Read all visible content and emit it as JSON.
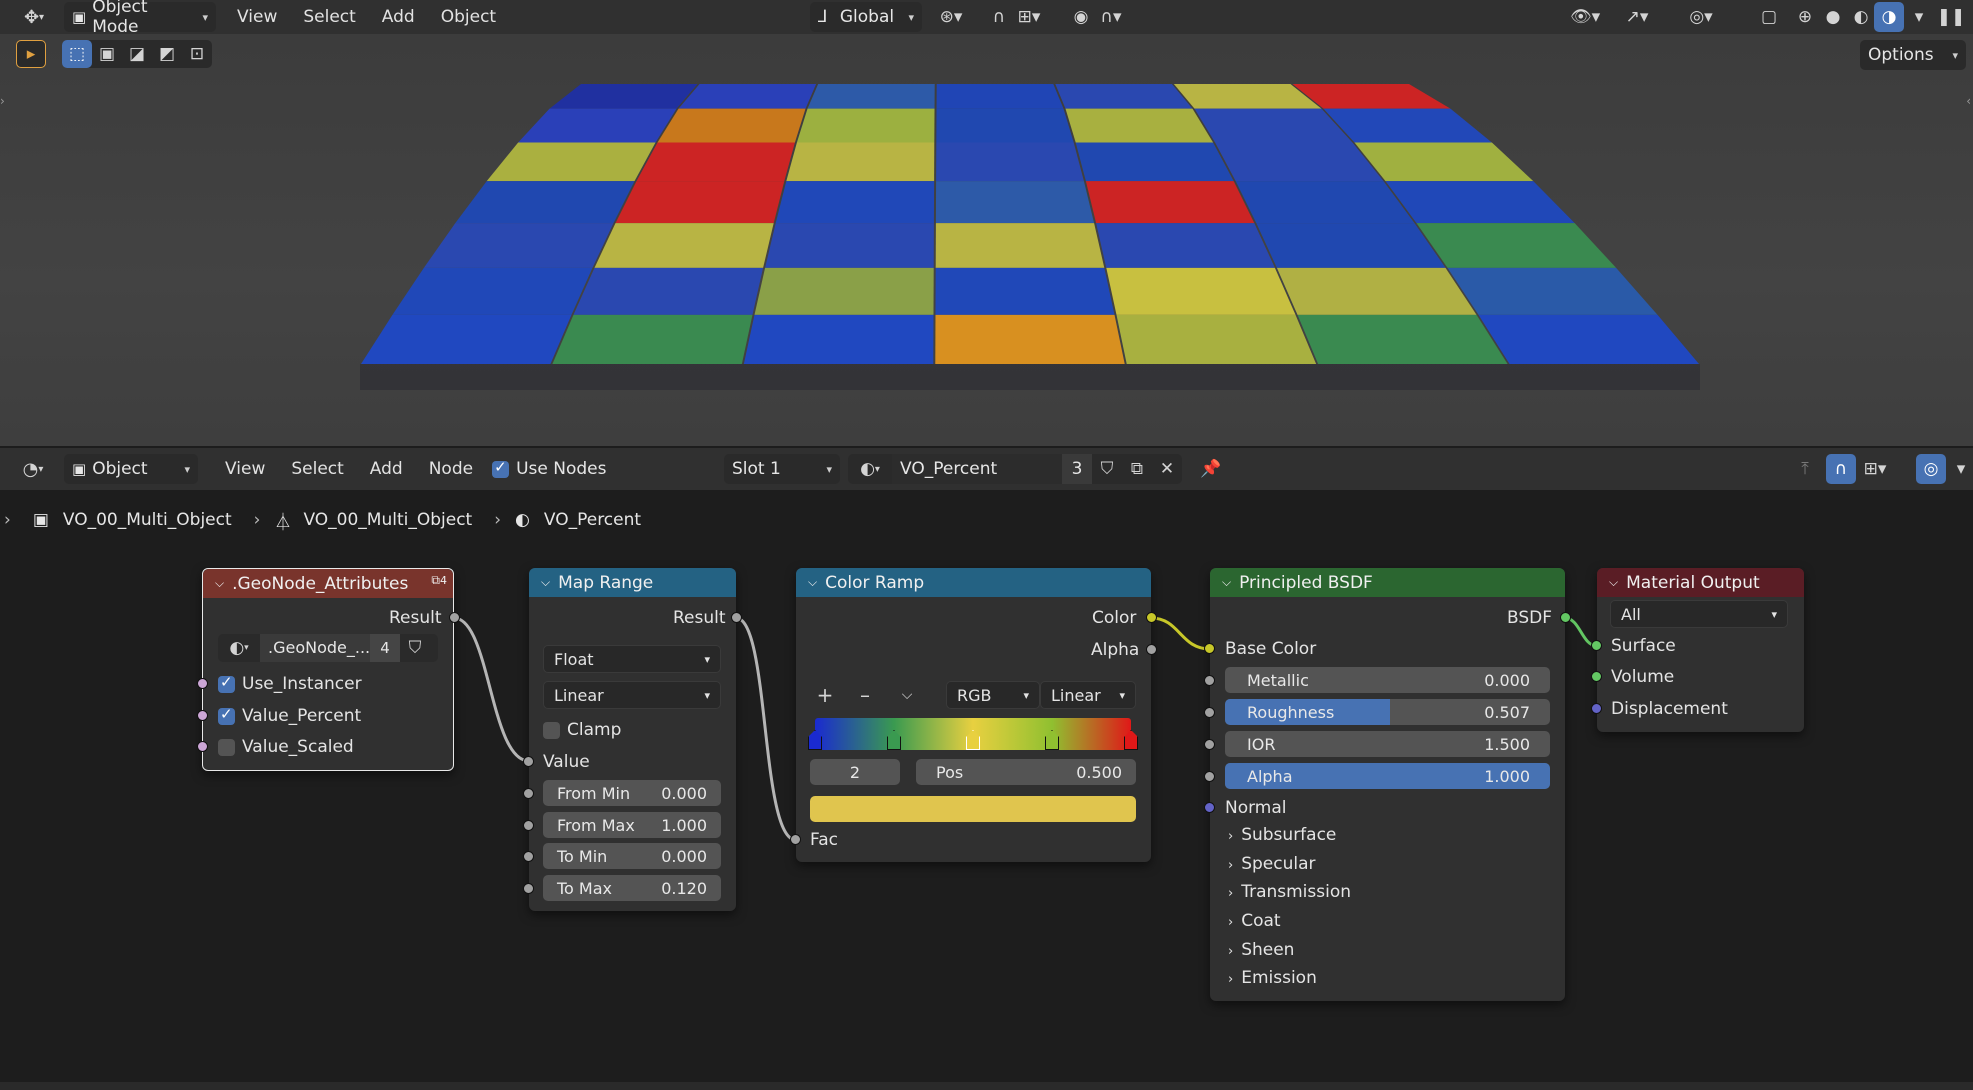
{
  "top_header": {
    "mode_label": "Object Mode",
    "menus": [
      "View",
      "Select",
      "Add",
      "Object"
    ],
    "orientation": "Global",
    "options_label": "Options"
  },
  "viewport": {
    "tile_colors": [
      [
        "#2030a0",
        "#2a40b8",
        "#2d5aa8",
        "#2045b5",
        "#2a48b0",
        "#b8b444",
        "#cc2424"
      ],
      [
        "#2a40b8",
        "#c8781c",
        "#9cb040",
        "#2048b0",
        "#a8b040",
        "#2a48b0",
        "#2248b8"
      ],
      [
        "#aab040",
        "#cc2424",
        "#b8b444",
        "#2a48b0",
        "#2048b0",
        "#2a48b0",
        "#a0b040"
      ],
      [
        "#2048b0",
        "#cc2424",
        "#2048b8",
        "#2d5aa8",
        "#cc2424",
        "#2048b0",
        "#2048b8"
      ],
      [
        "#2a48b0",
        "#b8b444",
        "#2a48b0",
        "#b8b444",
        "#2a48b0",
        "#2048b0",
        "#3a8a50"
      ],
      [
        "#2048b8",
        "#2a48b0",
        "#8aa048",
        "#2048b8",
        "#c8c040",
        "#b0b044",
        "#2a5aa8"
      ],
      [
        "#2048c0",
        "#3a8a50",
        "#2048c0",
        "#d89020",
        "#a8b040",
        "#3a8a50",
        "#2048c0"
      ]
    ]
  },
  "node_header": {
    "editor_type": "Object",
    "menus": [
      "View",
      "Select",
      "Add",
      "Node"
    ],
    "use_nodes_label": "Use Nodes",
    "slot": "Slot 1",
    "material_name": "VO_Percent",
    "user_count": "3"
  },
  "breadcrumb": {
    "object": "VO_00_Multi_Object",
    "mesh": "VO_00_Multi_Object",
    "material": "VO_Percent"
  },
  "nodes": {
    "geonode": {
      "title": ".GeoNode_Attributes",
      "badge": "4",
      "output": "Result",
      "datablock": ".GeoNode_...",
      "datablock_count": "4",
      "inputs": [
        {
          "label": "Use_Instancer",
          "checked": true
        },
        {
          "label": "Value_Percent",
          "checked": true
        },
        {
          "label": "Value_Scaled",
          "checked": false
        }
      ]
    },
    "map_range": {
      "title": "Map Range",
      "output": "Result",
      "data_type": "Float",
      "interpolation": "Linear",
      "clamp_label": "Clamp",
      "value_label": "Value",
      "fields": [
        {
          "label": "From Min",
          "value": "0.000"
        },
        {
          "label": "From Max",
          "value": "1.000"
        },
        {
          "label": "To Min",
          "value": "0.000"
        },
        {
          "label": "To Max",
          "value": "0.120"
        }
      ]
    },
    "color_ramp": {
      "title": "Color Ramp",
      "outputs": [
        "Color",
        "Alpha"
      ],
      "color_mode": "RGB",
      "interpolation": "Linear",
      "active_index": "2",
      "pos_label": "Pos",
      "pos_value": "0.500",
      "active_color": "#e0c54e",
      "input": "Fac",
      "stops": [
        {
          "pos": 0.0,
          "color": "#1a2ad0"
        },
        {
          "pos": 0.25,
          "color": "#3a9a50"
        },
        {
          "pos": 0.5,
          "color": "#e8d040"
        },
        {
          "pos": 0.75,
          "color": "#90c030"
        },
        {
          "pos": 1.0,
          "color": "#e01818"
        }
      ]
    },
    "bsdf": {
      "title": "Principled BSDF",
      "output": "BSDF",
      "base_color_label": "Base Color",
      "fields": [
        {
          "label": "Metallic",
          "value": "0.000",
          "fill": 0.0
        },
        {
          "label": "Roughness",
          "value": "0.507",
          "fill": 0.507
        },
        {
          "label": "IOR",
          "value": "1.500",
          "fill": 0.0
        },
        {
          "label": "Alpha",
          "value": "1.000",
          "fill": 1.0
        }
      ],
      "normal_label": "Normal",
      "panels": [
        "Subsurface",
        "Specular",
        "Transmission",
        "Coat",
        "Sheen",
        "Emission"
      ]
    },
    "material_output": {
      "title": "Material Output",
      "target": "All",
      "inputs": [
        "Surface",
        "Volume",
        "Displacement"
      ]
    }
  },
  "colors": {
    "input_header": "#79342c",
    "converter_header": "#246283",
    "shader_header": "#2b6630",
    "output_header": "#5a1d25",
    "socket_gray": "#a1a1a1",
    "socket_yellow": "#c7c729",
    "socket_green": "#63c763",
    "socket_purple": "#6363c7",
    "socket_pink": "#cca6d6",
    "accent": "#4772b3"
  }
}
